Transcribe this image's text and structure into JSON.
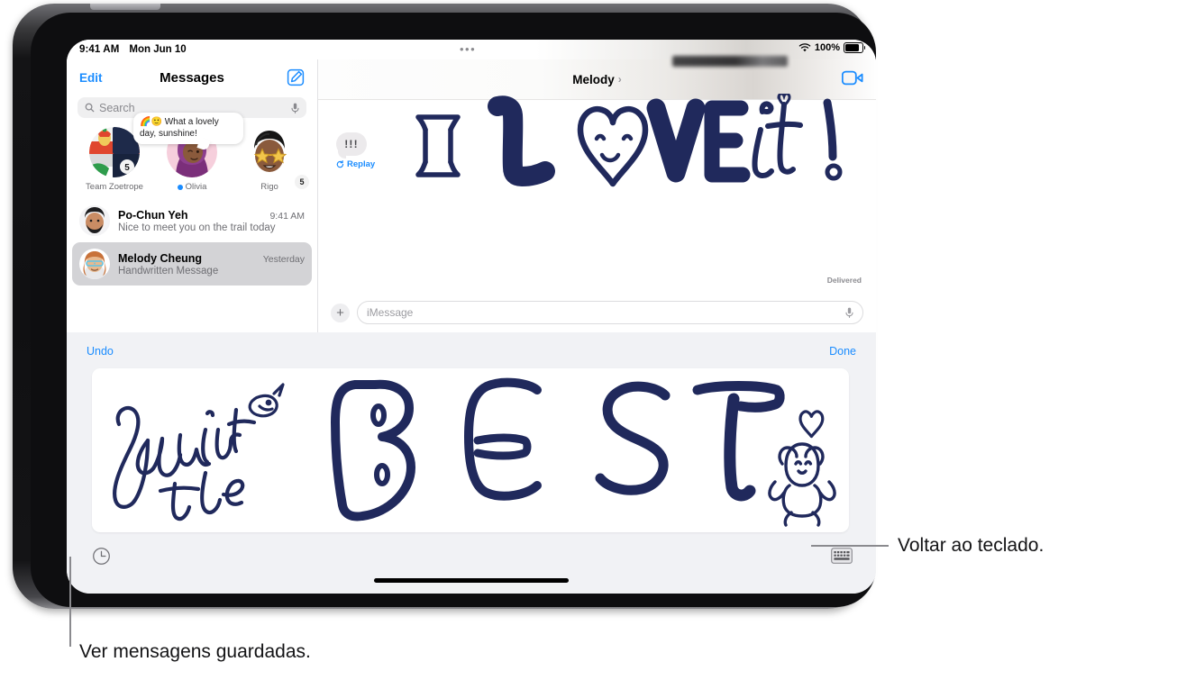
{
  "device": {
    "status_bar": {
      "time": "9:41 AM",
      "date": "Mon Jun 10",
      "battery_percent": "100%",
      "wifi_icon": "wifi-icon",
      "battery_icon": "battery-icon",
      "more_dots": "•••"
    }
  },
  "sidebar": {
    "edit_label": "Edit",
    "title": "Messages",
    "compose_icon": "compose-icon",
    "search": {
      "placeholder": "Search",
      "search_icon": "search-icon",
      "mic_icon": "microphone-icon"
    },
    "pinned": [
      {
        "name": "Team Zoetrope",
        "badge": "5",
        "has_dot": false,
        "avatar": "group-avatar"
      },
      {
        "name": "Olivia",
        "badge": "",
        "has_dot": true,
        "avatar": "memoji-olivia"
      },
      {
        "name": "Rigo",
        "badge": "",
        "has_dot": false,
        "avatar": "memoji-rigo"
      }
    ],
    "tip_bubble": {
      "emoji": "🌈🙂",
      "text": "What a lovely day, sunshine!"
    },
    "conversations": [
      {
        "name": "Po-Chun Yeh",
        "time": "9:41 AM",
        "preview": "Nice to meet you on the trail today",
        "selected": false
      },
      {
        "name": "Melody Cheung",
        "time": "Yesterday",
        "preview": "Handwritten Message",
        "selected": true
      }
    ]
  },
  "conversation": {
    "title": "Melody",
    "chevron": "›",
    "facetime_icon": "facetime-video-icon",
    "effect_bubble": {
      "text": "!!!",
      "replay_label": "Replay",
      "replay_icon": "replay-icon"
    },
    "handwritten_message": "I L♥VE it!",
    "delivered_label": "Delivered",
    "input": {
      "plus_icon": "plus-icon",
      "placeholder": "iMessage",
      "mic_icon": "microphone-icon"
    }
  },
  "handwriting_panel": {
    "undo_label": "Undo",
    "done_label": "Done",
    "canvas_text": "You're the BEST",
    "saved_messages_icon": "clock-icon",
    "keyboard_icon": "keyboard-icon"
  },
  "callouts": [
    {
      "id": "keyboard-callout",
      "text": "Voltar ao teclado."
    },
    {
      "id": "saved-messages-callout",
      "text": "Ver mensagens guardadas."
    }
  ],
  "colors": {
    "accent": "#1a8cff",
    "ink": "#20295c",
    "panel_bg": "#f1f2f5",
    "selected_row": "#d3d3d6"
  }
}
